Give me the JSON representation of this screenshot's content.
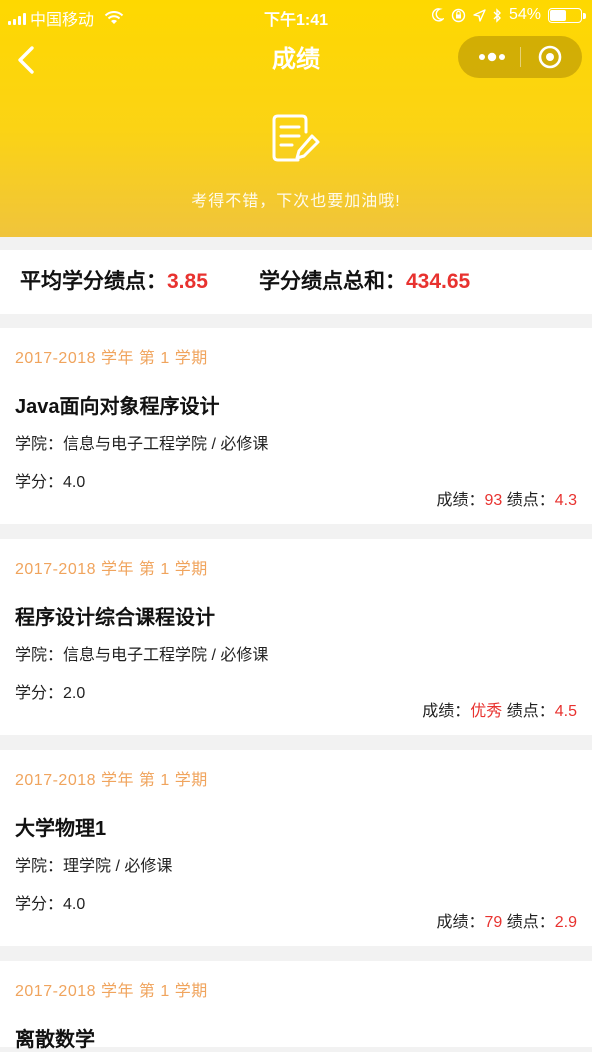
{
  "status_bar": {
    "carrier": "中国移动",
    "time": "下午1:41",
    "battery": "54%",
    "battery_level": 0.54
  },
  "nav": {
    "title": "成绩",
    "back_icon": "chevron-left-icon",
    "more_icon": "more-dots-icon",
    "close_icon": "target-circle-icon"
  },
  "header": {
    "icon": "note-edit-icon",
    "message": "考得不错，下次也要加油哦!"
  },
  "summary": {
    "avg_label": "平均学分绩点：",
    "avg_value": "3.85",
    "total_label": "学分绩点总和：",
    "total_value": "434.65"
  },
  "courses": [
    {
      "term": "2017-2018 学年 第 1 学期",
      "name": "Java面向对象程序设计",
      "college": "学院：信息与电子工程学院 / 必修课",
      "credit": "学分：4.0",
      "score_label": "成绩：",
      "score": "93",
      "gpa_label": "绩点：",
      "gpa": "4.3"
    },
    {
      "term": "2017-2018 学年 第 1 学期",
      "name": "程序设计综合课程设计",
      "college": "学院：信息与电子工程学院 / 必修课",
      "credit": "学分：2.0",
      "score_label": "成绩：",
      "score": "优秀",
      "gpa_label": "绩点：",
      "gpa": "4.5"
    },
    {
      "term": "2017-2018 学年 第 1 学期",
      "name": "大学物理1",
      "college": "学院：理学院 / 必修课",
      "credit": "学分：4.0",
      "score_label": "成绩：",
      "score": "79",
      "gpa_label": "绩点：",
      "gpa": "2.9"
    },
    {
      "term": "2017-2018 学年 第 1 学期",
      "name": "离散数学",
      "college": "",
      "credit": "",
      "score_label": "",
      "score": "",
      "gpa_label": "",
      "gpa": ""
    }
  ],
  "colors": {
    "header_yellow": "#fed800",
    "accent_red": "#e8322f",
    "term_orange": "#f0a45d"
  }
}
